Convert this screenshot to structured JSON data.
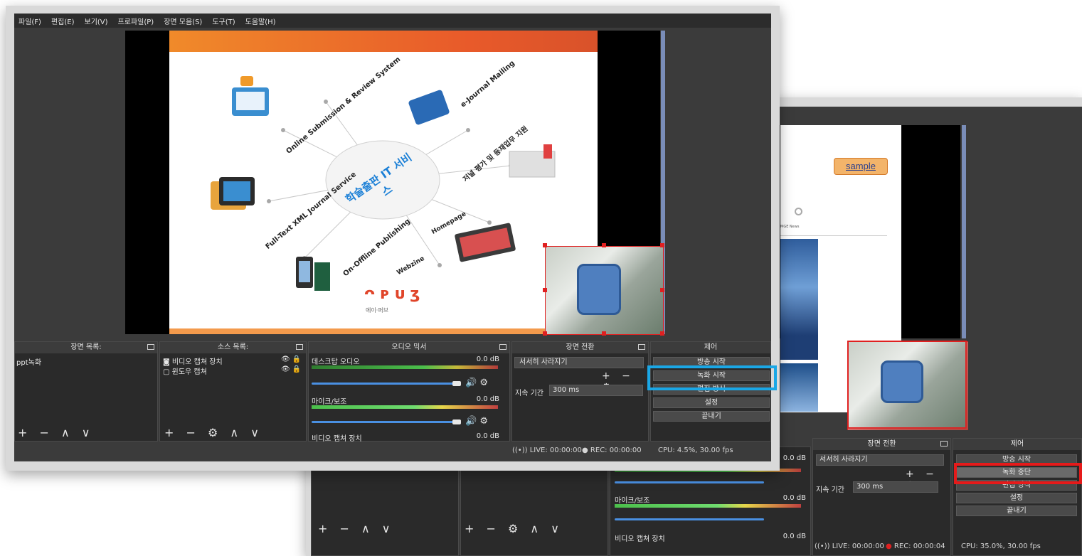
{
  "menu": [
    "파일(F)",
    "편집(E)",
    "보기(V)",
    "프로파일(P)",
    "장면 모음(S)",
    "도구(T)",
    "도움말(H)"
  ],
  "slide": {
    "items": [
      "Online Submission & Review System",
      "e-Journal Mailing",
      "저널 평가 및 등재업무 지원",
      "Full-Text XML Journal Service",
      "학술출판 IT 서비스",
      "On-Offline Publishing",
      "Homepage",
      "Webzine"
    ],
    "logo_text": "에이·퍼브"
  },
  "front": {
    "scenes_title": "장면 목록:",
    "scene_item": "ppt녹화",
    "sources_title": "소스 목록:",
    "sources": [
      "비디오 캡쳐 장치",
      "윈도우 캡쳐"
    ],
    "mixer_title": "오디오 믹서",
    "channels": [
      {
        "name": "데스크탑 오디오",
        "db": "0.0 dB"
      },
      {
        "name": "마이크/보조",
        "db": "0.0 dB"
      },
      {
        "name": "비디오 캡쳐 장치",
        "db": "0.0 dB"
      }
    ],
    "transition_title": "장면 전환",
    "transition_value": "서서히 사라지기",
    "duration_label": "지속 기간",
    "duration_value": "300 ms",
    "control_title": "제어",
    "buttons": [
      "방송 시작",
      "녹화 시작",
      "편집 방식",
      "설정",
      "끝내기"
    ],
    "status": {
      "live": "LIVE: 00:00:00",
      "rec": "REC: 00:00:00",
      "cpu": "CPU: 4.5%, 30.00 fps"
    }
  },
  "back": {
    "sample_label": "sample",
    "news_label": "MGE News",
    "transition_title": "장면 전환",
    "transition_value": "서서히 사라지기",
    "duration_label": "지속 기간",
    "duration_value": "300 ms",
    "control_title": "제어",
    "buttons": [
      "방송 시작",
      "녹화 중단",
      "편집 방식",
      "설정",
      "끝내기"
    ],
    "db": [
      "0.0 dB",
      "0.0 dB",
      "0.0 dB"
    ],
    "mic_label": "마이크/보조",
    "video_label": "비디오 캡쳐 장치",
    "status": {
      "live": "LIVE: 00:00:00",
      "rec": "REC: 00:00:04",
      "cpu": "CPU: 35.0%, 30.00 fps"
    }
  }
}
